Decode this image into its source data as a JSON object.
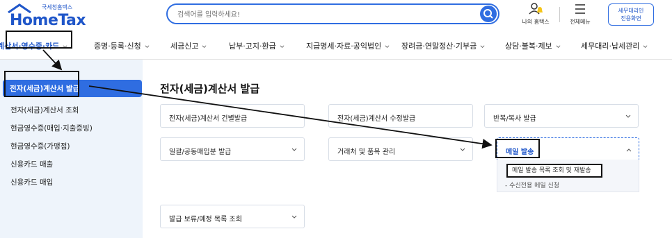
{
  "header": {
    "logo_sub": "국세청홈택스",
    "logo_main": "HomeTax",
    "search_placeholder": "검색어를 입력하세요!",
    "my_hometax": "나의 홈택스",
    "all_menu": "전체메뉴",
    "tax_agent_line1": "세무대리인",
    "tax_agent_line2": "전용화면"
  },
  "gnb": {
    "items": [
      "계산서·영수증·카드",
      "증명·등록·신청",
      "세금신고",
      "납부·고지·환급",
      "지급명세·자료·공익법인",
      "장려금·연말정산·기부금",
      "상담·불복·제보",
      "세무대리·납세관리"
    ]
  },
  "sidebar": {
    "items": [
      "전자(세금)계산서 발급",
      "전자(세금)계산서 조회",
      "현금영수증(매입·지출증빙)",
      "현금영수증(가맹점)",
      "신용카드 매출",
      "신용카드 매입"
    ]
  },
  "main": {
    "title": "전자(세금)계산서 발급",
    "cards": [
      "전자(세금)계산서 건별발급",
      "전자(세금)계산서 수정발급",
      "반복/복사 발급",
      "일괄/공동매입분 발급",
      "거래처 및 품목 관리",
      "메일 발송",
      "발급 보류/예정 목록 조회"
    ],
    "dropdown": [
      "메일 발송 목록 조회 및 재발송",
      "- 수신전용 메일 신청"
    ]
  },
  "colors": {
    "brand": "#1f56c9",
    "accent": "#2f6de1",
    "sidebar_bg": "#eef4fb"
  }
}
